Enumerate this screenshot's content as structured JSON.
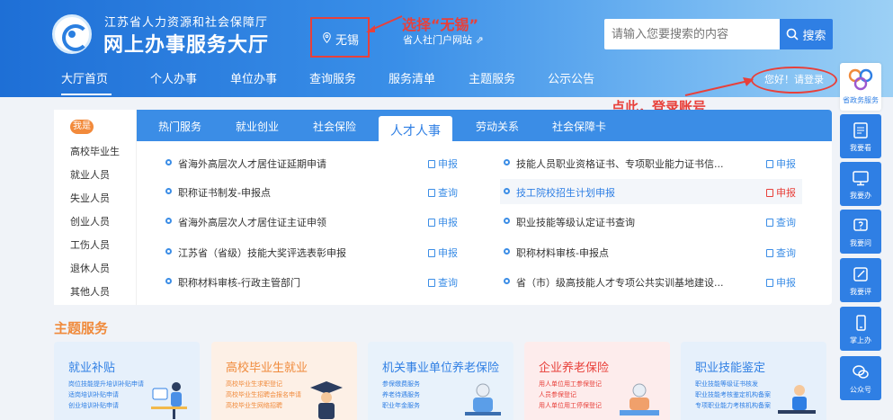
{
  "header": {
    "org_name": "江苏省人力资源和社会保障厅",
    "site_name": "网上办事服务大厅",
    "city": "无锡",
    "portal_link": "省人社门户网站 ⇗",
    "search_placeholder": "请输入您要搜索的内容",
    "search_button": "搜索",
    "login": "您好！请登录"
  },
  "annotations": {
    "city": "选择“无锡”",
    "login": "点此，登录账号"
  },
  "nav": [
    "大厅首页",
    "个人办事",
    "单位办事",
    "查询服务",
    "服务清单",
    "主题服务",
    "公示公告"
  ],
  "sidebar": {
    "badge": "我是",
    "items": [
      "高校毕业生",
      "就业人员",
      "失业人员",
      "创业人员",
      "工伤人员",
      "退休人员",
      "其他人员"
    ]
  },
  "tabs": [
    "热门服务",
    "就业创业",
    "社会保险",
    "人才人事",
    "劳动关系",
    "社会保障卡"
  ],
  "services_left": [
    {
      "name": "省海外高层次人才居住证延期申请",
      "action": "申报"
    },
    {
      "name": "职称证书制发-申报点",
      "action": "查询"
    },
    {
      "name": "省海外高层次人才居住证主证申领",
      "action": "申报"
    },
    {
      "name": "江苏省（省级）技能大奖评选表彰申报",
      "action": "申报"
    },
    {
      "name": "职称材料审核-行政主管部门",
      "action": "查询"
    }
  ],
  "services_right": [
    {
      "name": "技能人员职业资格证书、专项职业能力证书信...",
      "action": "申报"
    },
    {
      "name": "技工院校招生计划申报",
      "action": "申报"
    },
    {
      "name": "职业技能等级认定证书查询",
      "action": "查询"
    },
    {
      "name": "职称材料审核-申报点",
      "action": "查询"
    },
    {
      "name": "省（市）级高技能人才专项公共实训基地建设...",
      "action": "申报"
    }
  ],
  "theme": {
    "title": "主题服务",
    "cards": [
      {
        "title": "就业补贴",
        "lines": [
          "岗位技能提升培训补贴申请",
          "适岗培训补贴申请",
          "创业培训补贴申请"
        ],
        "color": "#2f7fe4",
        "bg": "#e6f0fb"
      },
      {
        "title": "高校毕业生就业",
        "lines": [
          "高校毕业生求职登记",
          "高校毕业生招聘会报名申请",
          "高校毕业生网络招聘"
        ],
        "color": "#f08a3b",
        "bg": "#fdf0e6"
      },
      {
        "title": "机关事业单位养老保险",
        "lines": [
          "参保缴费服务",
          "养老待遇服务",
          "职业年金服务"
        ],
        "color": "#2f7fe4",
        "bg": "#e8f2fb"
      },
      {
        "title": "企业养老保险",
        "lines": [
          "用人单位用工参保登记",
          "人员参保登记",
          "用人单位用工停保登记"
        ],
        "color": "#e8403a",
        "bg": "#fdecec"
      },
      {
        "title": "职业技能鉴定",
        "lines": [
          "职业技能等级证书核发",
          "职业技能考核鉴定机构备案",
          "专项职业能力考核机构备案"
        ],
        "color": "#2f7fe4",
        "bg": "#e6f0fb"
      }
    ]
  },
  "float_menu": [
    "省政务服务",
    "我要看",
    "我要办",
    "我要问",
    "我要评",
    "掌上办",
    "公众号"
  ]
}
